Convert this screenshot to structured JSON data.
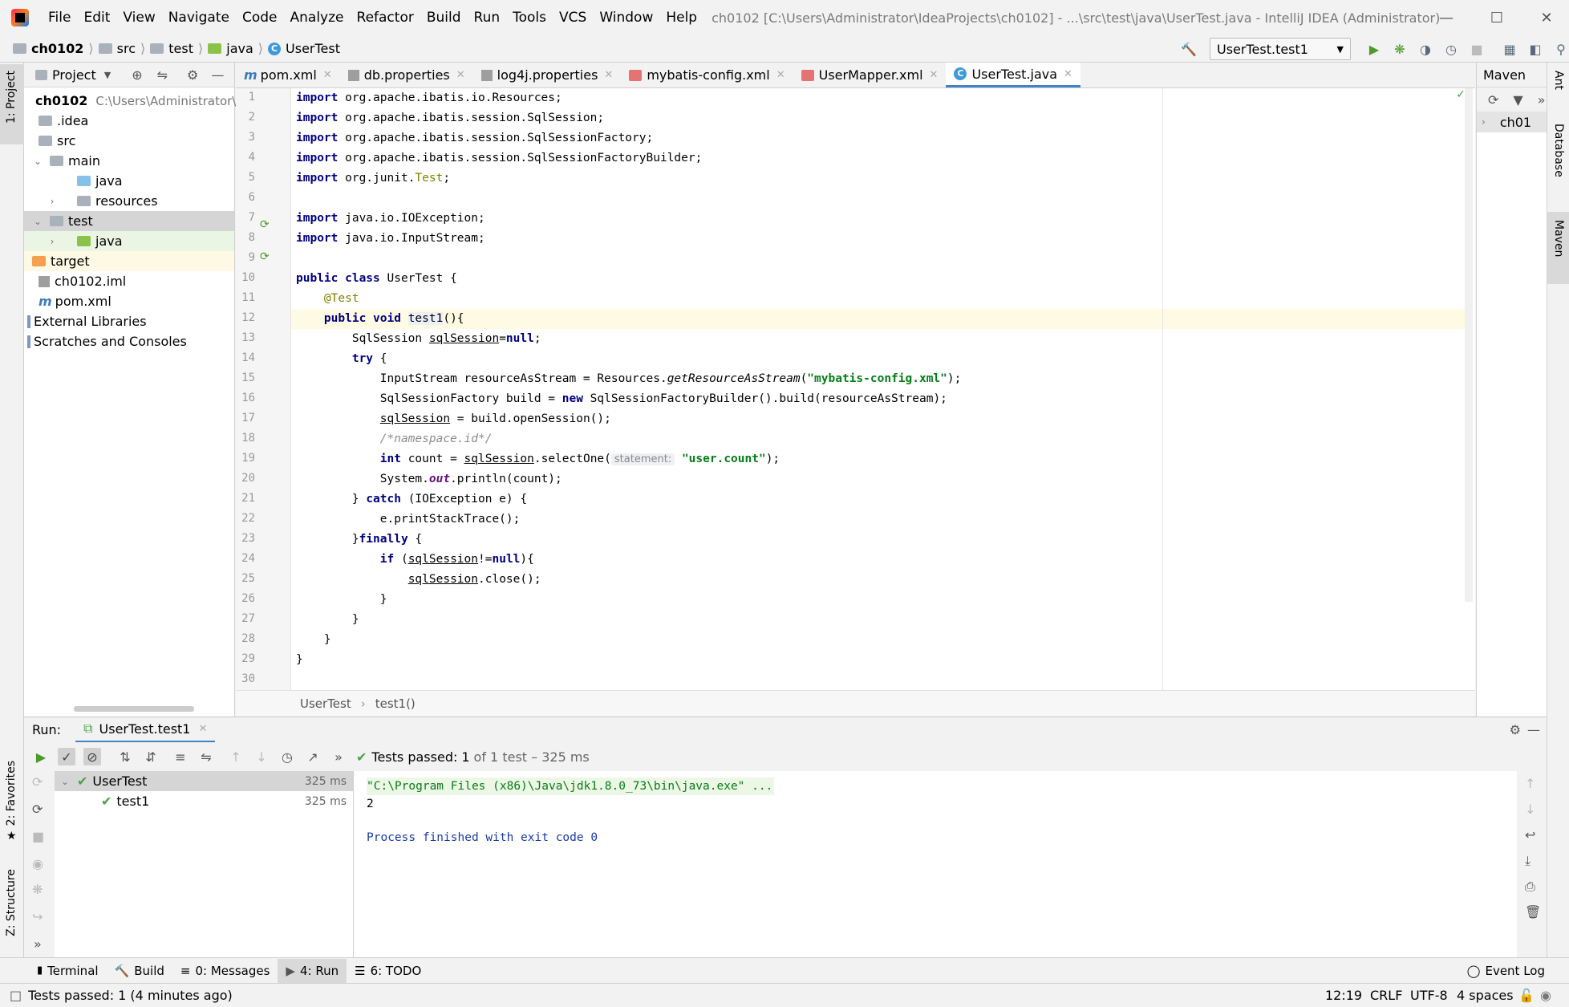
{
  "titlebar": {
    "menus": [
      "File",
      "Edit",
      "View",
      "Navigate",
      "Code",
      "Analyze",
      "Refactor",
      "Build",
      "Run",
      "Tools",
      "VCS",
      "Window",
      "Help"
    ],
    "window_title": "ch0102 [C:\\Users\\Administrator\\IdeaProjects\\ch0102] - ...\\src\\test\\java\\UserTest.java - IntelliJ IDEA (Administrator)"
  },
  "navbar": {
    "crumbs": [
      "ch0102",
      "src",
      "test",
      "java",
      "UserTest"
    ],
    "run_config": "UserTest.test1"
  },
  "left_strip": {
    "project": "1: Project",
    "favorites": "2: Favorites",
    "structure": "Z: Structure"
  },
  "right_strip": {
    "ant": "Ant",
    "database": "Database",
    "maven": "Maven"
  },
  "project": {
    "title": "Project",
    "root_name": "ch0102",
    "root_path": "C:\\Users\\Administrator\\Id",
    "items": [
      ".idea",
      "src",
      "main",
      "java",
      "resources",
      "test",
      "java",
      "target",
      "ch0102.iml",
      "pom.xml",
      "External Libraries",
      "Scratches and Consoles"
    ]
  },
  "tabs": [
    "pom.xml",
    "db.properties",
    "log4j.properties",
    "mybatis-config.xml",
    "UserMapper.xml",
    "UserTest.java"
  ],
  "editor": {
    "line_numbers": [
      "1",
      "2",
      "3",
      "4",
      "5",
      "6",
      "7",
      "8",
      "9",
      "10",
      "11",
      "12",
      "13",
      "14",
      "15",
      "16",
      "17",
      "18",
      "19",
      "20",
      "21",
      "22",
      "23",
      "24",
      "25",
      "26",
      "27",
      "28",
      "29",
      "30"
    ],
    "code": {
      "l1_kw": "import",
      "l1": " org.apache.ibatis.io.Resources;",
      "l2_kw": "import",
      "l2": " org.apache.ibatis.session.SqlSession;",
      "l3_kw": "import",
      "l3": " org.apache.ibatis.session.SqlSessionFactory;",
      "l4_kw": "import",
      "l4": " org.apache.ibatis.session.SqlSessionFactoryBuilder;",
      "l5_kw": "import",
      "l5a": " org.junit.",
      "l5_ann": "Test",
      "l5b": ";",
      "l7_kw": "import",
      "l7": " java.io.IOException;",
      "l8_kw": "import",
      "l8": " java.io.InputStream;",
      "l10_kw": "public class",
      "l10": " UserTest {",
      "l11_ann": "@Test",
      "l12_kw": "public void",
      "l12_name": "test1",
      "l12": "(){",
      "l13a": "SqlSession ",
      "l13_var": "sqlSession",
      "l13b": "=",
      "l13_kw": "null",
      "l13c": ";",
      "l14_kw": "try",
      "l14": " {",
      "l15a": "InputStream resourceAsStream = Resources.",
      "l15_it": "getResourceAsStream",
      "l15b": "(",
      "l15_str": "\"mybatis-config.xml\"",
      "l15c": ");",
      "l16a": "SqlSessionFactory build = ",
      "l16_kw": "new",
      "l16b": " SqlSessionFactoryBuilder().build(resourceAsStream);",
      "l17_var": "sqlSession",
      "l17": " = build.openSession();",
      "l18_cmt": "/*namespace.id*/",
      "l19_kw": "int",
      "l19a": " count = ",
      "l19_var": "sqlSession",
      "l19b": ".selectOne(",
      "l19_hint": "statement:",
      "l19_str": "\"user.count\"",
      "l19c": ");",
      "l20a": "System.",
      "l20_field": "out",
      "l20b": ".println(count);",
      "l21a": "} ",
      "l21_kw": "catch",
      "l21b": " (IOException e) {",
      "l22": "e.printStackTrace();",
      "l23a": "}",
      "l23_kw": "finally",
      "l23b": " {",
      "l24_kw": "if",
      "l24a": " (",
      "l24_var": "sqlSession",
      "l24b": "!=",
      "l24_kw2": "null",
      "l24c": "){",
      "l25_var": "sqlSession",
      "l25": ".close();",
      "l26": "}",
      "l27": "}",
      "l28": "}",
      "l29": "}"
    }
  },
  "editor_crumb": [
    "UserTest",
    "test1()"
  ],
  "maven": {
    "title": "Maven",
    "root": "ch01"
  },
  "run": {
    "label": "Run:",
    "tab": "UserTest.test1",
    "status_prefix": "Tests passed:",
    "status_count": "1",
    "status_suffix": "of 1 test – 325 ms",
    "tree": [
      {
        "name": "UserTest",
        "time": "325 ms"
      },
      {
        "name": "test1",
        "time": "325 ms"
      }
    ],
    "console": [
      "\"C:\\Program Files (x86)\\Java\\jdk1.8.0_73\\bin\\java.exe\" ...",
      "2",
      "",
      "Process finished with exit code 0"
    ]
  },
  "bottom_tabs": [
    "Terminal",
    "Build",
    "0: Messages",
    "4: Run",
    "6: TODO"
  ],
  "event_log": "Event Log",
  "statusbar": {
    "message": "Tests passed: 1 (4 minutes ago)",
    "position": "12:19",
    "line_sep": "CRLF",
    "encoding": "UTF-8",
    "indent": "4 spaces"
  },
  "colors": {
    "accent": "#4083c9",
    "keyword": "#000080",
    "string": "#067d17",
    "success": "#49a24a"
  }
}
